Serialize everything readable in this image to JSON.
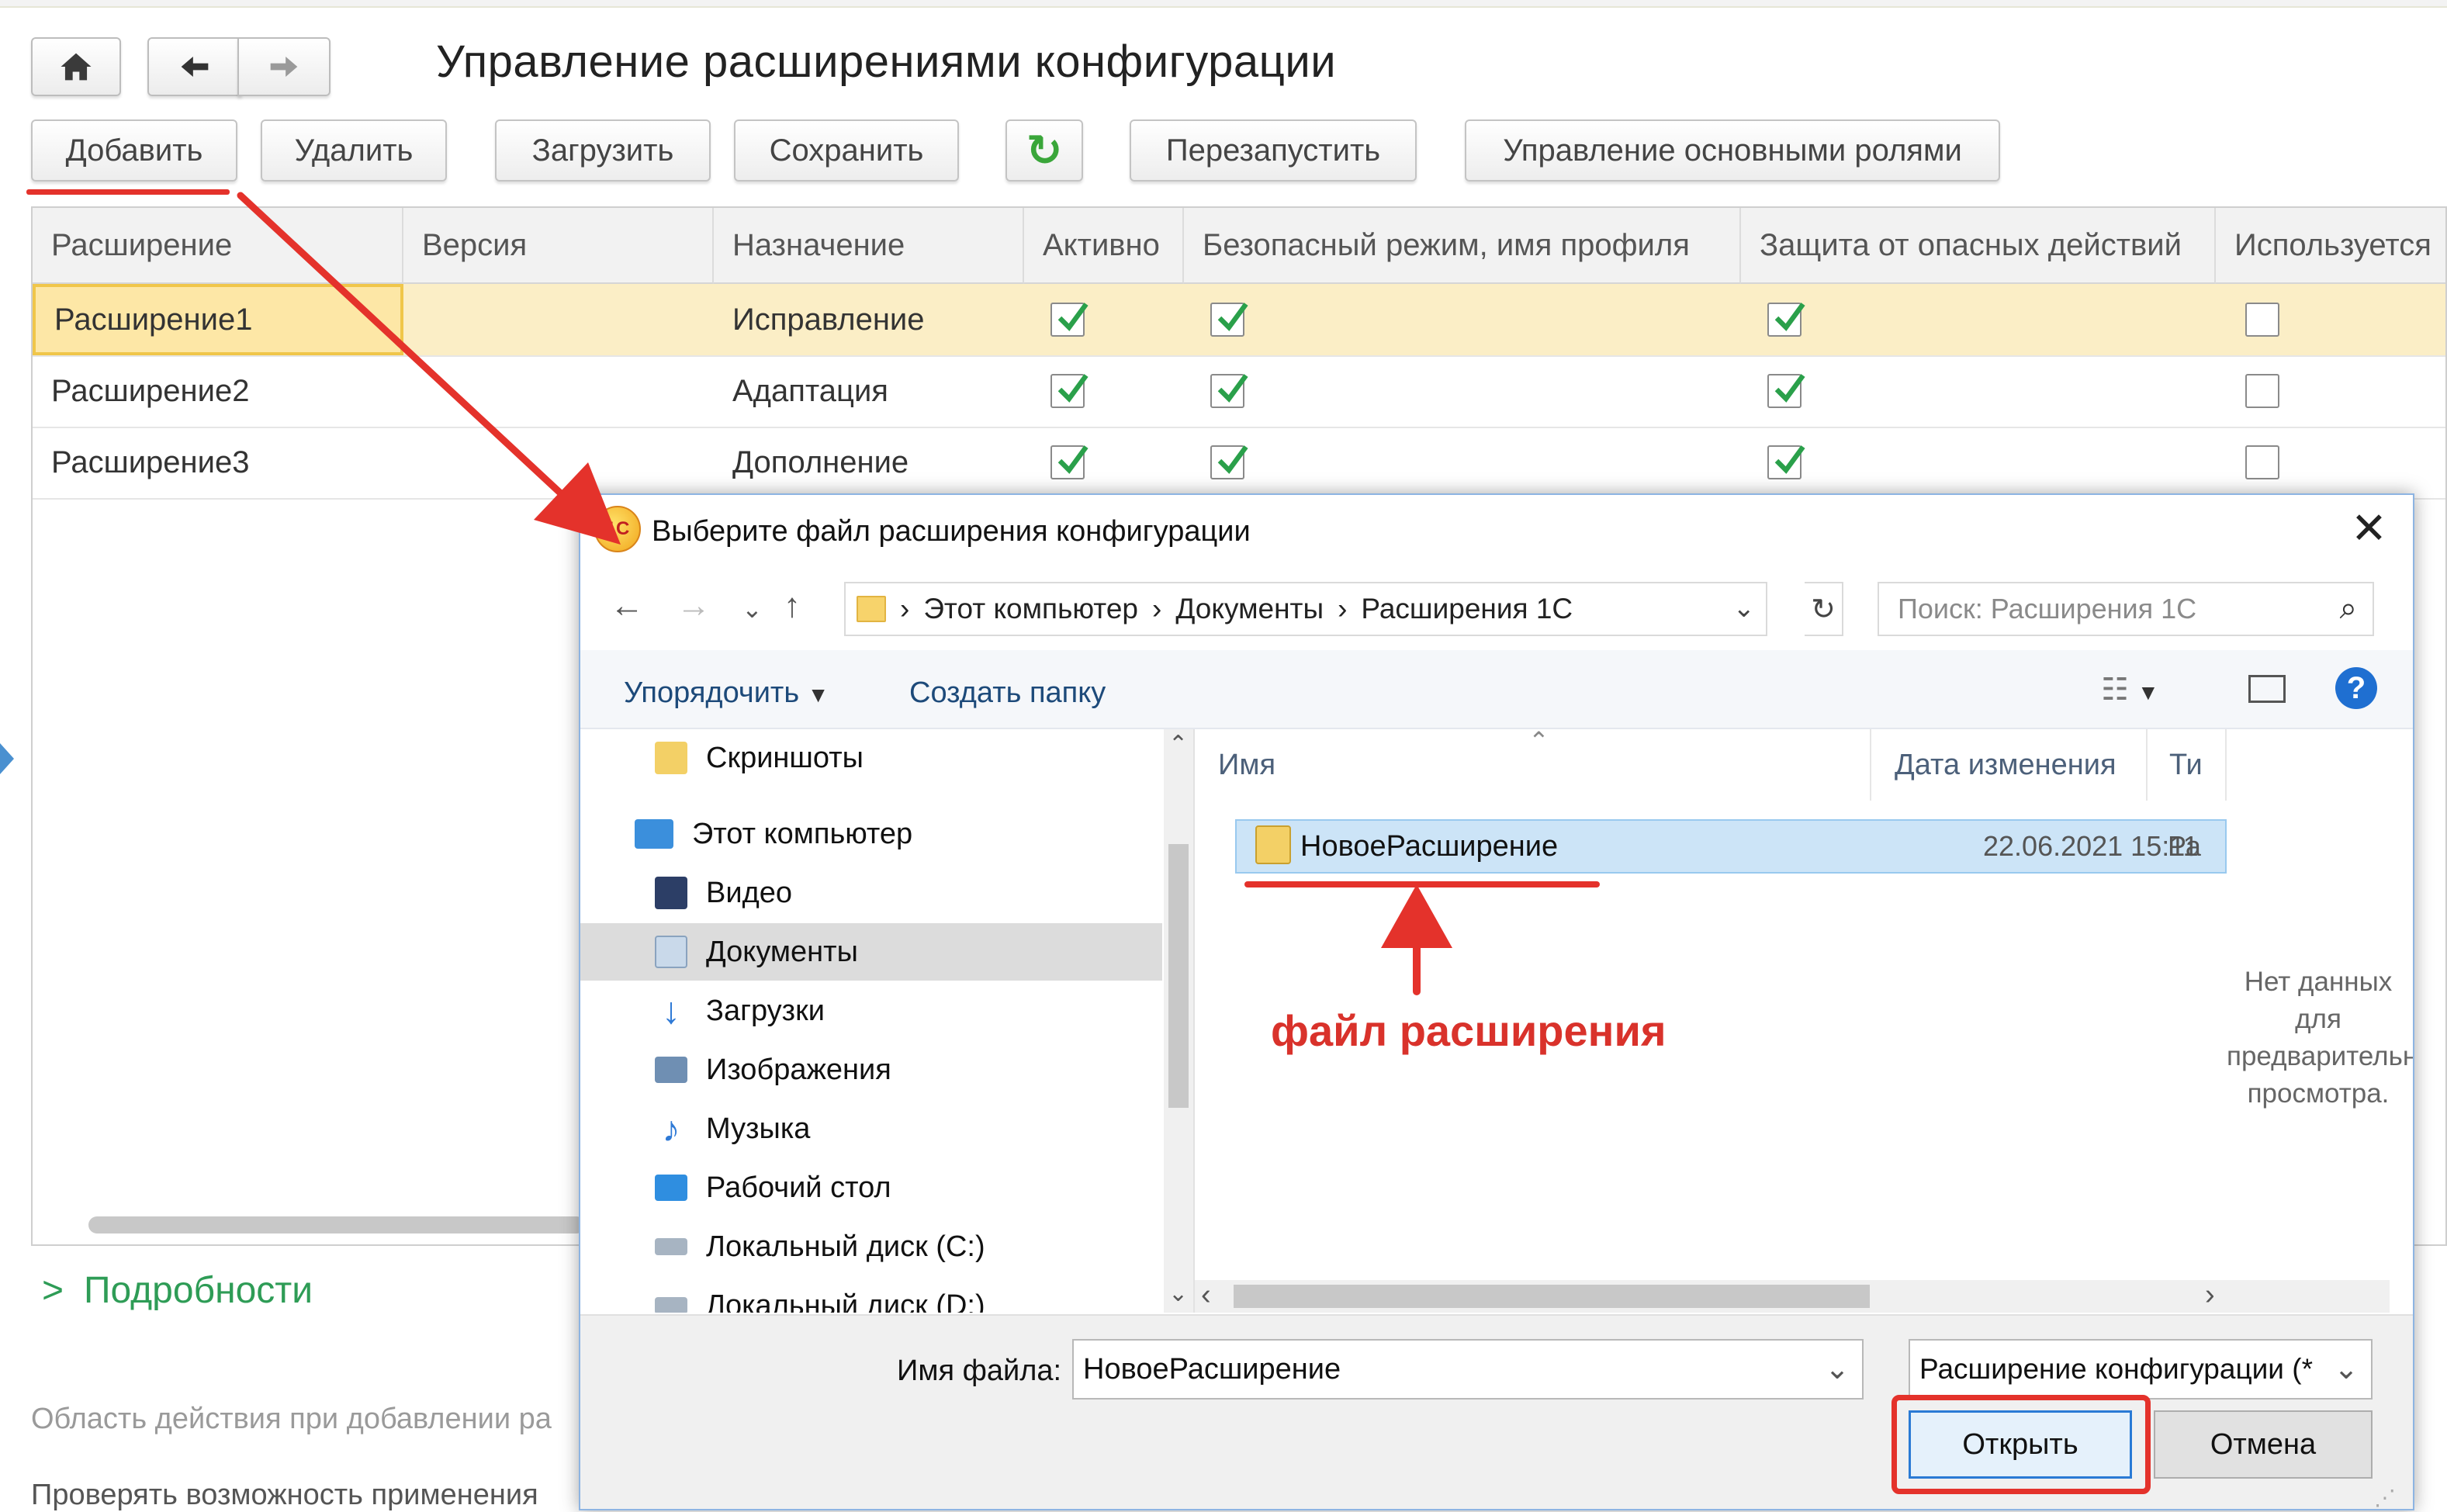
{
  "title": "Управление расширениями конфигурации",
  "toolbar": {
    "add": "Добавить",
    "delete": "Удалить",
    "load": "Загрузить",
    "save": "Сохранить",
    "restart": "Перезапустить",
    "roles": "Управление основными ролями"
  },
  "table": {
    "columns": [
      "Расширение",
      "Версия",
      "Назначение",
      "Активно",
      "Безопасный режим, имя профиля",
      "Защита от опасных действий",
      "Используется"
    ],
    "rows": [
      {
        "name": "Расширение1",
        "version": "",
        "purpose": "Исправление",
        "active": true,
        "safe": true,
        "protect": true,
        "used": false
      },
      {
        "name": "Расширение2",
        "version": "",
        "purpose": "Адаптация",
        "active": true,
        "safe": true,
        "protect": true,
        "used": false
      },
      {
        "name": "Расширение3",
        "version": "",
        "purpose": "Дополнение",
        "active": true,
        "safe": true,
        "protect": true,
        "used": false
      }
    ]
  },
  "details_label": "Подробности",
  "hint1": "Область действия при добавлении ра",
  "hint2": "Проверять возможность применения",
  "dialog": {
    "logo_text": "1С",
    "title": "Выберите файл расширения конфигурации",
    "path": [
      "Этот компьютер",
      "Документы",
      "Расширения 1С"
    ],
    "search_placeholder": "Поиск: Расширения 1С",
    "organize": "Упорядочить",
    "new_folder": "Создать папку",
    "tree": [
      {
        "label": "Скриншоты",
        "icon": "screenshots-folder-icon",
        "indent": 1,
        "color": "#f3d066"
      },
      {
        "label": "Этот компьютер",
        "icon": "computer-icon",
        "indent": 0,
        "color": "#3b8fdc"
      },
      {
        "label": "Видео",
        "icon": "video-icon",
        "indent": 1,
        "color": "#2c3e66"
      },
      {
        "label": "Документы",
        "icon": "documents-icon",
        "indent": 1,
        "color": "#c9d9ea",
        "selected": true
      },
      {
        "label": "Загрузки",
        "icon": "downloads-icon",
        "indent": 1,
        "color": "#2f7ad6"
      },
      {
        "label": "Изображения",
        "icon": "pictures-icon",
        "indent": 1,
        "color": "#6f8fb3"
      },
      {
        "label": "Музыка",
        "icon": "music-icon",
        "indent": 1,
        "color": "#2f7ad6"
      },
      {
        "label": "Рабочий стол",
        "icon": "desktop-icon",
        "indent": 1,
        "color": "#2f8ee0"
      },
      {
        "label": "Локальный диск (C:)",
        "icon": "drive-c-icon",
        "indent": 1,
        "color": "#a7b4c2"
      },
      {
        "label": "Локальный диск (D:)",
        "icon": "drive-d-icon",
        "indent": 1,
        "color": "#a7b4c2"
      }
    ],
    "columns": {
      "name": "Имя",
      "date": "Дата изменения",
      "type": "Ти"
    },
    "file": {
      "name": "НовоеРасширение",
      "date": "22.06.2021 15:11",
      "type": "Ра"
    },
    "annotation": "файл расширения",
    "no_preview": "Нет данных для предварительного просмотра.",
    "filename_label": "Имя файла:",
    "filename_value": "НовоеРасширение",
    "filetype": "Расширение конфигурации (*",
    "open": "Открыть",
    "cancel": "Отмена"
  },
  "colors": {
    "accent_red": "#e4322b",
    "check_green": "#2aa04a",
    "details_green": "#2e9c56",
    "selected_row": "#fbeec6"
  }
}
